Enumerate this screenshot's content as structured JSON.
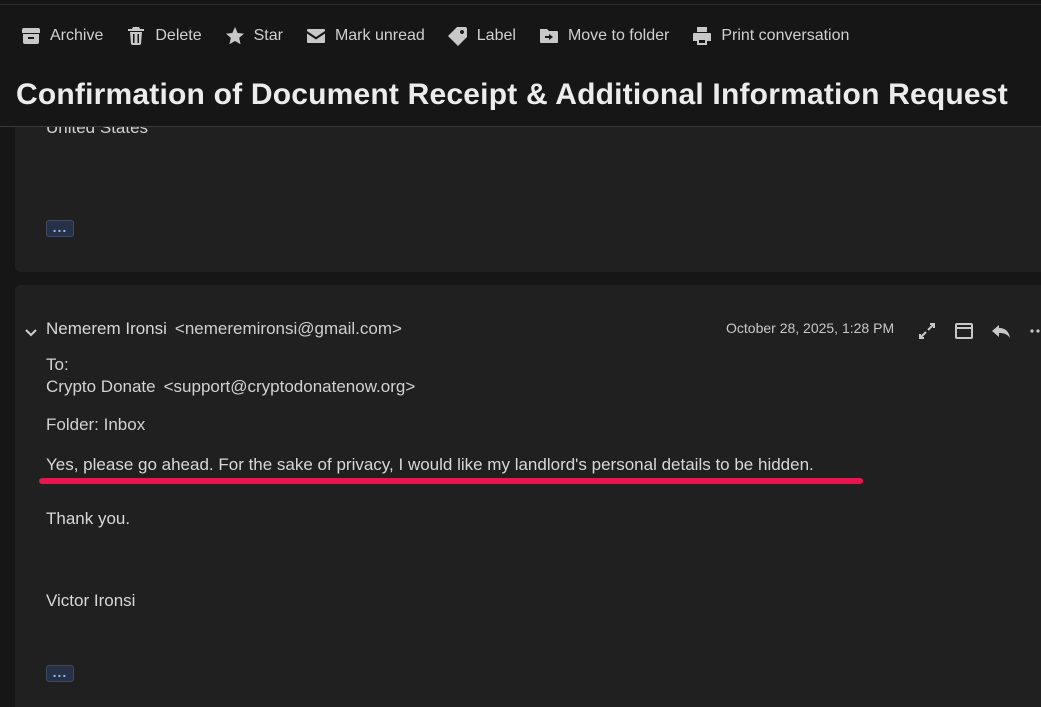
{
  "toolbar": {
    "items": [
      {
        "label": "Archive",
        "icon": "archive-icon"
      },
      {
        "label": "Delete",
        "icon": "trash-icon"
      },
      {
        "label": "Star",
        "icon": "star-icon"
      },
      {
        "label": "Mark unread",
        "icon": "envelope-icon"
      },
      {
        "label": "Label",
        "icon": "tag-icon"
      },
      {
        "label": "Move to folder",
        "icon": "folder-move-icon"
      },
      {
        "label": "Print conversation",
        "icon": "printer-icon"
      }
    ]
  },
  "subject": "Confirmation of Document Receipt & Additional Information Request",
  "previous_message": {
    "address_tail": "United States",
    "more_label": "..."
  },
  "message": {
    "sender_name": "Nemerem Ironsi",
    "sender_email": "<nemeremironsi@gmail.com>",
    "date": "October 28, 2025, 1:28 PM",
    "to_label": "To:",
    "to_name": "Crypto Donate",
    "to_email": "<support@cryptodonatenow.org>",
    "folder": "Folder: Inbox",
    "body_line1": "Yes, please go ahead. For the sake of privacy, I would like my landlord's personal details to be hidden.",
    "body_line2": "Thank you.",
    "signature": "Victor Ironsi",
    "more_label": "..."
  },
  "colors": {
    "background": "#161616",
    "card": "#202020",
    "highlight": "#e8154e",
    "more_button_text": "#8fb3ff"
  }
}
